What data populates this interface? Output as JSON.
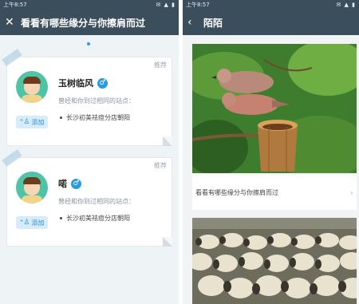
{
  "left": {
    "status_time": "上午8:57",
    "status_icons": "✉ ▲ ▮",
    "title": "看看有哪些缘分与你擦肩而过",
    "cards": [
      {
        "recommend": "推荐",
        "name": "玉树临风",
        "gender": "♂",
        "subtitle": "曾经和你到过相同的站点：",
        "station": "长沙初美祛痘分店朝阳",
        "add": "添加"
      },
      {
        "recommend": "推荐",
        "name": "喏",
        "gender": "♂",
        "subtitle": "曾经和你到过相同的站点：",
        "station": "长沙初美祛痘分店朝阳",
        "add": "添加"
      }
    ]
  },
  "right": {
    "status_time": "上午8:57",
    "status_icons": "✉ ▲ ▮",
    "title": "陌陌",
    "feed_caption": "看看有哪些缘分与你擦肩而过"
  }
}
